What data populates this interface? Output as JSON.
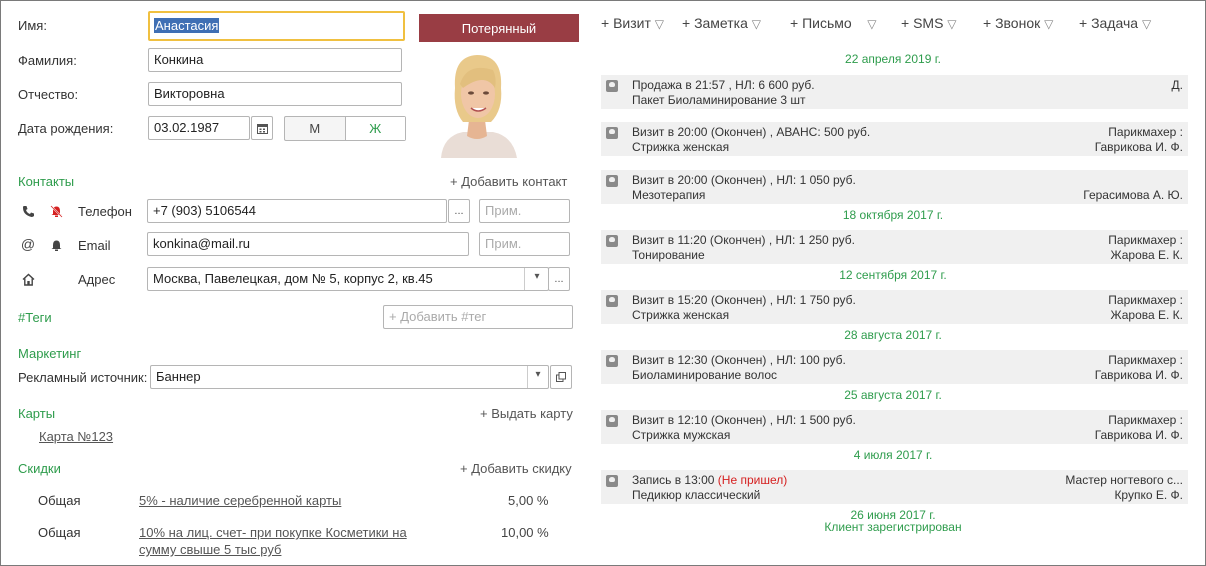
{
  "form": {
    "first_name_label": "Имя:",
    "first_name_value": "Анастасия",
    "last_name_label": "Фамилия:",
    "last_name_value": "Конкина",
    "patronymic_label": "Отчество:",
    "patronymic_value": "Викторовна",
    "birth_label": "Дата рождения:",
    "birth_value": "03.02.1987",
    "gender_m": "М",
    "gender_f": "Ж",
    "lost_button": "Потерянный"
  },
  "contacts": {
    "title": "Контакты",
    "add": "+ Добавить контакт",
    "phone_label": "Телефон",
    "phone_value": "+7 (903) 5106544",
    "email_label": "Email",
    "email_value": "konkina@mail.ru",
    "address_label": "Адрес",
    "address_value": "Москва, Павелецкая, дом № 5, корпус 2, кв.45",
    "note_placeholder": "Прим.",
    "dots": "...",
    "dropdown": "▾"
  },
  "tags": {
    "title": "#Теги",
    "placeholder": "+ Добавить #тег"
  },
  "marketing": {
    "title": "Маркетинг",
    "source_label": "Рекламный источник:",
    "source_value": "Баннер"
  },
  "cards": {
    "title": "Карты",
    "add": "+ Выдать карту",
    "items": [
      "Карта №123"
    ]
  },
  "discounts": {
    "title": "Скидки",
    "add": "+ Добавить скидку",
    "items": [
      {
        "type": "Общая",
        "name_line1": "5% - наличие серебренной карты",
        "name_line2": "",
        "value": "5,00 %"
      },
      {
        "type": "Общая",
        "name_line1": "10% на лиц. счет- при покупке Косметики  на",
        "name_line2": "сумму свыше 5 тыс руб",
        "value": "10,00 %"
      }
    ]
  },
  "toolbar": {
    "visit": "+ Визит",
    "note": "+ Заметка",
    "letter": "+ Письмо",
    "sms": "+ SMS",
    "call": "+ Звонок",
    "task": "+ Задача"
  },
  "timeline": {
    "d1": "22 апреля 2019 г.",
    "d2": "18 октября 2017 г.",
    "d3": "12 сентября 2017 г.",
    "d4": "28 августа 2017 г.",
    "d5": "25 августа 2017 г.",
    "d6": "4 июля 2017 г.",
    "d7": "26 июня 2017 г.",
    "registered": "Клиент зарегистрирован",
    "events": [
      {
        "l1": "Продажа в 21:57 , НЛ: 6 600 руб.",
        "l2": "Пакет Биоламинирование 3 шт",
        "r1": "Д.",
        "r2": ""
      },
      {
        "l1": "Визит в 20:00 (Окончен) , АВАНС: 500 руб.",
        "l2": "Стрижка женская",
        "r1": "Парикмахер :",
        "r2": "Гаврикова И. Ф."
      },
      {
        "l1": "Визит в 20:00 (Окончен) , НЛ: 1 050 руб.",
        "l2": "Мезотерапия",
        "r1": "",
        "r2": "Герасимова А. Ю."
      },
      {
        "l1": "Визит в 11:20 (Окончен) , НЛ: 1 250 руб.",
        "l2": "Тонирование",
        "r1": "Парикмахер :",
        "r2": "Жарова Е. К."
      },
      {
        "l1": "Визит в 15:20 (Окончен) , НЛ: 1 750 руб.",
        "l2": "Стрижка женская",
        "r1": "Парикмахер :",
        "r2": "Жарова Е. К."
      },
      {
        "l1": "Визит в 12:30 (Окончен) , НЛ: 100 руб.",
        "l2": "Биоламинирование волос",
        "r1": "Парикмахер :",
        "r2": "Гаврикова И. Ф."
      },
      {
        "l1": "Визит в 12:10 (Окончен) , НЛ: 1 500 руб.",
        "l2": "Стрижка мужская",
        "r1": "Парикмахер :",
        "r2": "Гаврикова И. Ф."
      },
      {
        "l1a": "Запись в 13:00 ",
        "l1b": "(Не пришел)",
        "l2": "Педикюр классический",
        "r1": "Мастер ногтевого с...",
        "r2": "Крупко Е. Ф."
      }
    ]
  },
  "colors": {
    "accent_green": "#2e9c4c",
    "lost_red": "#993d44",
    "selection_blue": "#3f6fb4",
    "focus_yellow": "#f0c040"
  }
}
